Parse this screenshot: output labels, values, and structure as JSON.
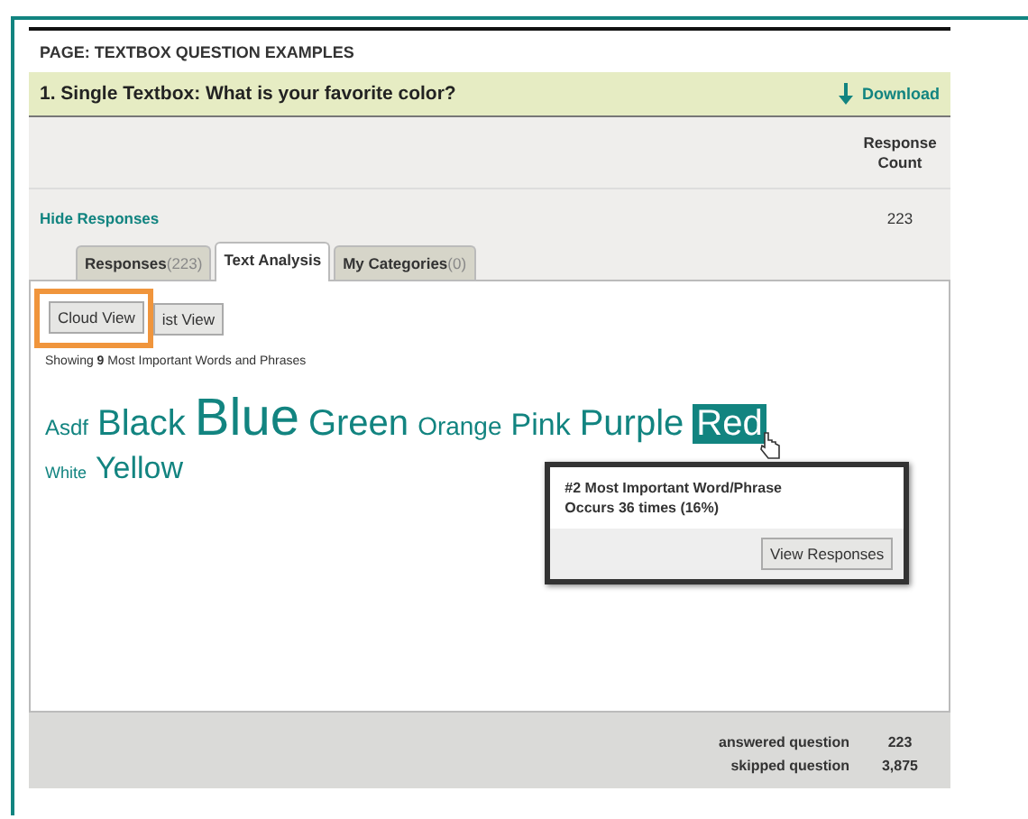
{
  "page_title": "PAGE: TEXTBOX QUESTION EXAMPLES",
  "question": {
    "title": "1. Single Textbox: What is your favorite color?",
    "download": "Download"
  },
  "column_header": "Response Count",
  "hide_responses": "Hide Responses",
  "response_count": "223",
  "tabs": [
    {
      "label": "Responses",
      "count": "(223)",
      "selected": false
    },
    {
      "label": "Text Analysis",
      "selected": true
    },
    {
      "label": "My Categories",
      "count": "(0)",
      "selected": false
    }
  ],
  "view_buttons": [
    {
      "label": "Cloud View",
      "highlighted": true
    },
    {
      "label": "ist View",
      "highlighted": false
    }
  ],
  "cloud_caption": "Showing **9** Most Important Words and Phrases",
  "word_rows": [
    [
      {
        "text": "Asdf",
        "kind": "small",
        "selected": false
      },
      {
        "text": "Black",
        "kind": "large",
        "selected": false
      },
      {
        "text": "Blue",
        "kind": "huge",
        "selected": false
      },
      {
        "text": "Green",
        "kind": "large",
        "selected": false
      },
      {
        "text": "Orange",
        "kind": "medium",
        "selected": false
      },
      {
        "text": "Pink",
        "kind": "big",
        "selected": false
      },
      {
        "text": "Purple",
        "kind": "large",
        "selected": false
      },
      {
        "text": "Red",
        "kind": "large",
        "selected": true
      }
    ],
    [
      {
        "text": "White",
        "kind": "tiny",
        "selected": false
      },
      {
        "text": "Yellow",
        "kind": "big",
        "selected": false
      }
    ]
  ],
  "tooltip": {
    "lines": [
      "#2 Most Important Word/Phrase",
      "Occurs 36 times (16%)"
    ],
    "button": "View Responses"
  },
  "summary": [
    {
      "label": "answered question",
      "value": "223"
    },
    {
      "label": "skipped question",
      "value": "3,875"
    }
  ]
}
